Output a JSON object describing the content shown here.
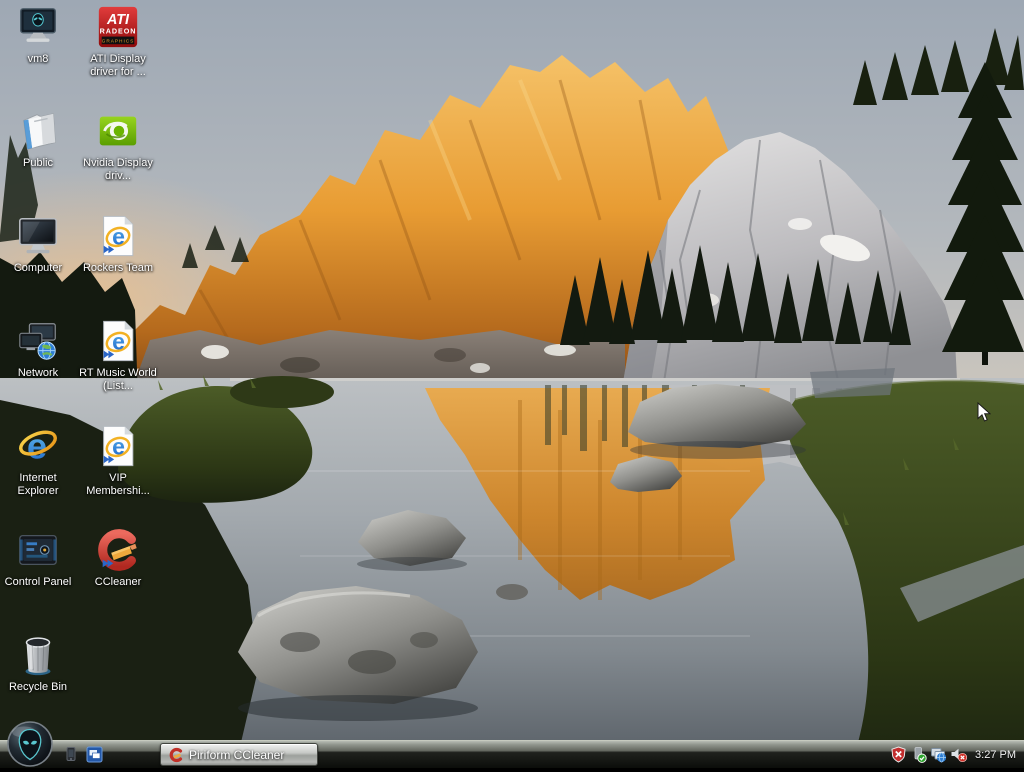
{
  "desktop": {
    "icons": [
      {
        "label": "vm8",
        "icon": "alienware-monitor"
      },
      {
        "label": "ATI Display driver for ...",
        "icon": "ati-radeon-logo"
      },
      {
        "label": "Public",
        "icon": "public-folder"
      },
      {
        "label": "Nvidia Display driv...",
        "icon": "nvidia-logo"
      },
      {
        "label": "Computer",
        "icon": "computer-monitor"
      },
      {
        "label": "Rockers Team",
        "icon": "ie-document"
      },
      {
        "label": "Network",
        "icon": "network-computers"
      },
      {
        "label": "RT Music World (List...",
        "icon": "ie-document"
      },
      {
        "label": "Internet Explorer",
        "icon": "internet-explorer"
      },
      {
        "label": "VIP Membershi...",
        "icon": "ie-document"
      },
      {
        "label": "Control Panel",
        "icon": "control-panel"
      },
      {
        "label": "CCleaner",
        "icon": "ccleaner-logo"
      },
      {
        "label": "Recycle Bin",
        "icon": "recycle-bin"
      }
    ]
  },
  "logos": {
    "ati": {
      "l1": "ATI",
      "l2": "RADEON",
      "l3": "GRAPHICS"
    }
  },
  "taskbar": {
    "running_app_label": "Piriform CCleaner",
    "clock": "3:27 PM"
  },
  "colors": {
    "sunset_orange": "#e89c33",
    "granite_gray": "#c4c4c8",
    "water_gray": "#9aa0a5",
    "grass_green": "#36431d",
    "taskbar_black": "#151713",
    "alien_teal": "#59c6ce"
  }
}
